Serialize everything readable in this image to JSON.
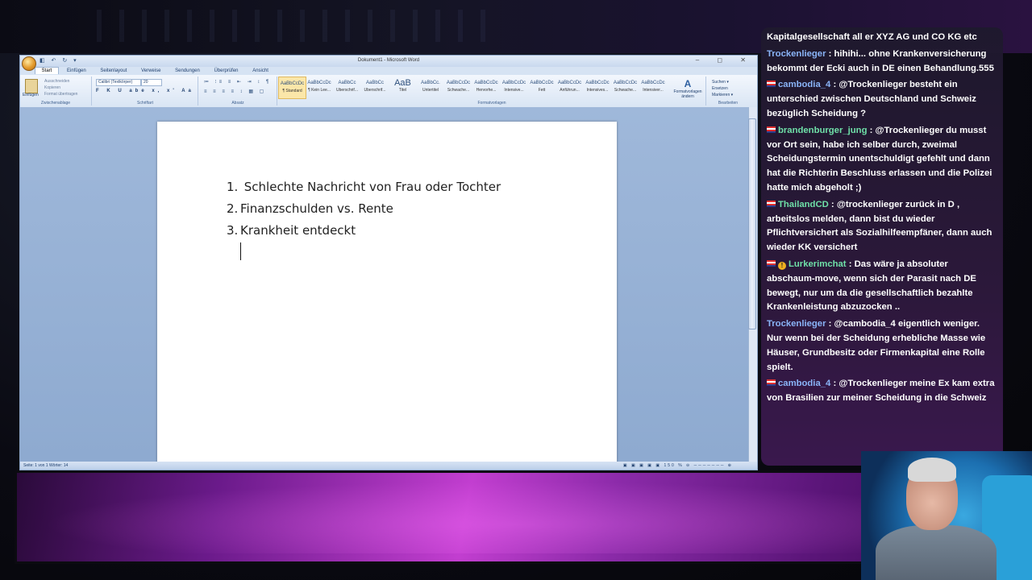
{
  "word": {
    "title": "Dokument1 - Microsoft Word",
    "quick_access": "◧ ↶ ↻ ▾",
    "window_controls": "– ◻ ✕",
    "tabs": [
      "Start",
      "Einfügen",
      "Seitenlayout",
      "Verweise",
      "Sendungen",
      "Überprüfen",
      "Ansicht"
    ],
    "ribbon": {
      "clipboard": {
        "paste": "Einfügen",
        "cut": "Ausschneiden",
        "copy": "Kopieren",
        "format_painter": "Format übertragen",
        "label": "Zwischenablage"
      },
      "font": {
        "name": "Calibri (Textkörper)",
        "size": "20",
        "format_buttons": "F K U abe x, x' Aa",
        "label": "Schriftart"
      },
      "paragraph": {
        "row1": "≔ ⁝≡ ≡ ⇤ ⇥ ↕ ¶",
        "row2": "≡ ≡ ≡ ≡ ↕ ▦ ▢",
        "label": "Absatz"
      },
      "styles": {
        "items": [
          {
            "sample": "AaBbCcDc",
            "name": "¶ Standard"
          },
          {
            "sample": "AaBbCcDc",
            "name": "¶ Kein Lee..."
          },
          {
            "sample": "AaBbCc",
            "name": "Überschrif..."
          },
          {
            "sample": "AaBbCc",
            "name": "Überschrif..."
          },
          {
            "sample": "AaB",
            "name": "Titel"
          },
          {
            "sample": "AaBbCc.",
            "name": "Untertitel"
          },
          {
            "sample": "AaBbCcDc",
            "name": "Schwache..."
          },
          {
            "sample": "AaBbCcDc",
            "name": "Hervorhe..."
          },
          {
            "sample": "AaBbCcDc",
            "name": "Intensive..."
          },
          {
            "sample": "AaBbCcDc",
            "name": "Fett"
          },
          {
            "sample": "AaBbCcDc",
            "name": "Anführun..."
          },
          {
            "sample": "AaBbCcDc",
            "name": "Intensives..."
          },
          {
            "sample": "AaBbCcDc",
            "name": "Schwache..."
          },
          {
            "sample": "AaBbCcDc",
            "name": "Intensiver..."
          }
        ],
        "change_styles": "Formatvorlagen ändern",
        "label": "Formatvorlagen"
      },
      "editing": {
        "find": "Suchen ▾",
        "replace": "Ersetzen",
        "select": "Markieren ▾",
        "label": "Bearbeiten"
      }
    },
    "document": {
      "items": [
        {
          "num": "1.",
          "text": " Schlechte Nachricht von Frau oder Tochter"
        },
        {
          "num": "2.",
          "text": "Finanzschulden vs. Rente"
        },
        {
          "num": "3.",
          "text": "Krankheit entdeckt"
        }
      ]
    },
    "status": {
      "left": "Seite: 1 von 1   Wörter: 14",
      "right": "▣ ▣ ▣ ▣ ▣  150 %  ⊖ ─────── ⊕"
    }
  },
  "chat": {
    "messages": [
      {
        "badge": "",
        "user": "",
        "user_color": "#ffffff",
        "text": "Kapitalgesellschaft all er XYZ AG und CO KG etc"
      },
      {
        "badge": "",
        "user": "Trockenlieger",
        "user_color": "#8ab4f8",
        "text": "hihihi... ohne Krankenversicherung bekommt der Ecki auch in DE einen Behandlung.555"
      },
      {
        "badge": "flag",
        "user": "cambodia_4",
        "user_color": "#8ab4f8",
        "text": "@Trockenlieger besteht ein unterschied zwischen Deutschland und Schweiz bezüglich Scheidung ?"
      },
      {
        "badge": "flag",
        "user": "brandenburger_jung",
        "user_color": "#6fe0a8",
        "text": "@Trockenlieger du musst vor Ort sein, habe ich selber durch, zweimal Scheidungstermin unentschuldigt gefehlt und dann hat die Richterin Beschluss erlassen und die Polizei hatte mich abgeholt ;)"
      },
      {
        "badge": "flag",
        "user": "ThailandCD",
        "user_color": "#6fe0a8",
        "text": "@trockenlieger zurück in D , arbeitslos melden, dann bist du wieder Pflichtversichert als Sozialhilfeempfäner, dann auch wieder KK versichert"
      },
      {
        "badge": "flag-gold",
        "user": "Lurkerimchat",
        "user_color": "#6fe0a8",
        "text": "Das wäre ja absoluter abschaum-move, wenn sich der Parasit nach DE bewegt, nur um da die gesellschaftlich bezahlte Krankenleistung abzuzocken .."
      },
      {
        "badge": "",
        "user": "Trockenlieger",
        "user_color": "#8ab4f8",
        "text": "@cambodia_4 eigentlich weniger. Nur wenn bei der Scheidung erhebliche Masse wie Häuser, Grundbesitz oder Firmenkapital eine Rolle spielt."
      },
      {
        "badge": "flag",
        "user": "cambodia_4",
        "user_color": "#8ab4f8",
        "text": "@Trockenlieger meine Ex kam extra von Brasilien zur meiner Scheidung in die Schweiz"
      }
    ]
  },
  "colors": {
    "chat_text": "#ffffff",
    "banner_accent": "#c23ed0",
    "word_frame": "#c5d6ec"
  }
}
